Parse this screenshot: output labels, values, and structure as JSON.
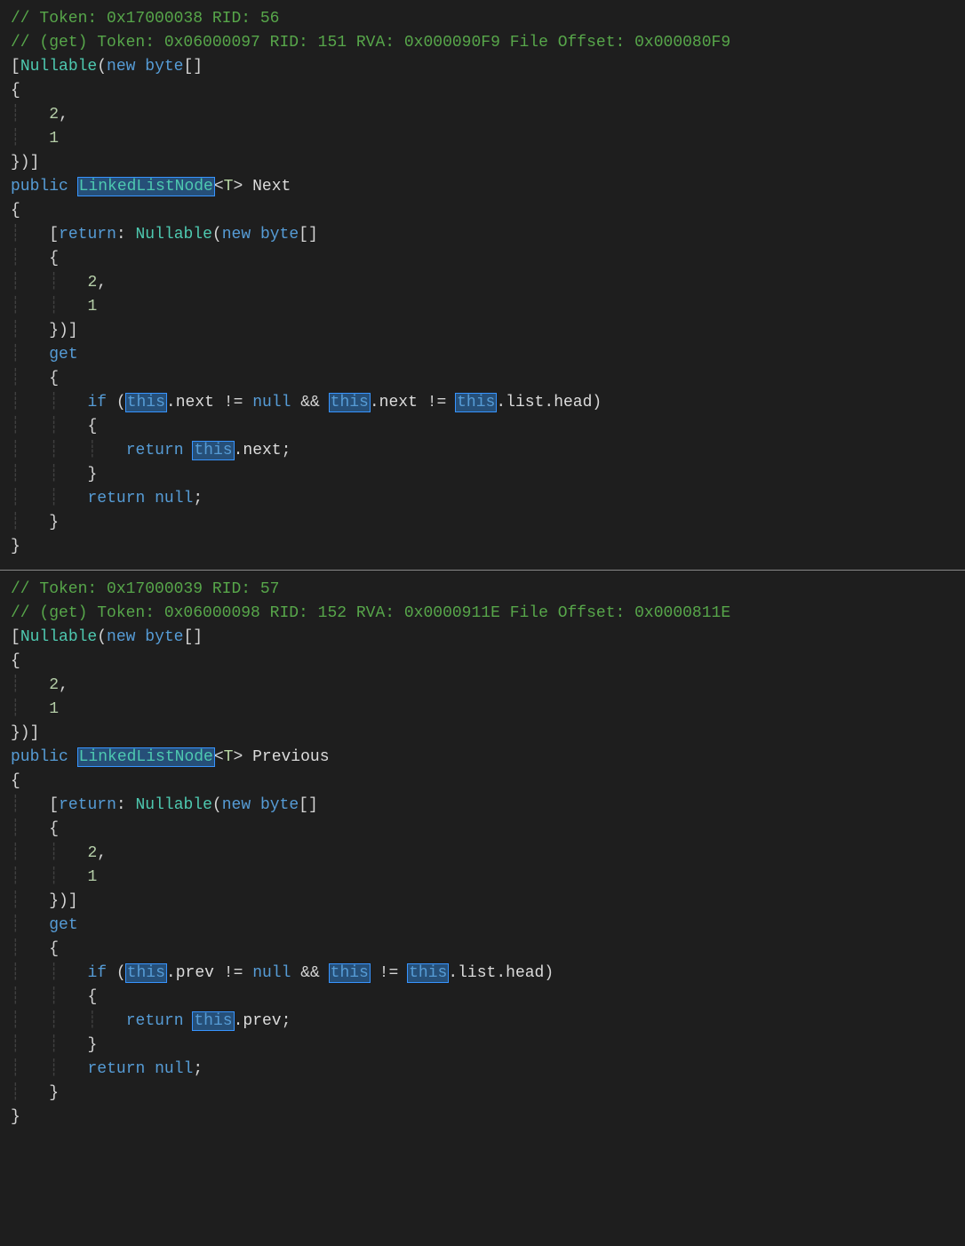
{
  "pane1": {
    "c1": "// Token: 0x17000038 RID: 56",
    "c2": "// (get) Token: 0x06000097 RID: 151 RVA: 0x000090F9 File Offset: 0x000080F9",
    "attrOpen": "[",
    "nullable": "Nullable",
    "lparen": "(",
    "new": "new",
    "byteArr": "byte",
    "arr": "[]",
    "brace_o": "{",
    "val2": "2",
    "comma": ",",
    "val1": "1",
    "brace_c_paren": "})]",
    "public": "public",
    "linkedListNode": "LinkedListNode",
    "lt": "<",
    "T": "T",
    "gt": ">",
    "propName": "Next",
    "return_attr": "return",
    "colon": ":",
    "get": "get",
    "if": "if",
    "this": "this",
    "dot": ".",
    "next": "next",
    "neq": "!=",
    "null": "null",
    "and": "&&",
    "list": "list",
    "head": "head",
    "rparen": ")",
    "return_kw": "return",
    "semi": ";",
    "cbrace": "}"
  },
  "pane2": {
    "c1": "// Token: 0x17000039 RID: 57",
    "c2": "// (get) Token: 0x06000098 RID: 152 RVA: 0x0000911E File Offset: 0x0000811E",
    "nullable": "Nullable",
    "new": "new",
    "byteArr": "byte",
    "arr": "[]",
    "val2": "2",
    "val1": "1",
    "public": "public",
    "linkedListNode": "LinkedListNode",
    "T": "T",
    "propName": "Previous",
    "return_attr": "return",
    "get": "get",
    "if": "if",
    "this": "this",
    "prev": "prev",
    "neq": "!=",
    "null": "null",
    "and": "&&",
    "list": "list",
    "head": "head",
    "return_kw": "return"
  }
}
